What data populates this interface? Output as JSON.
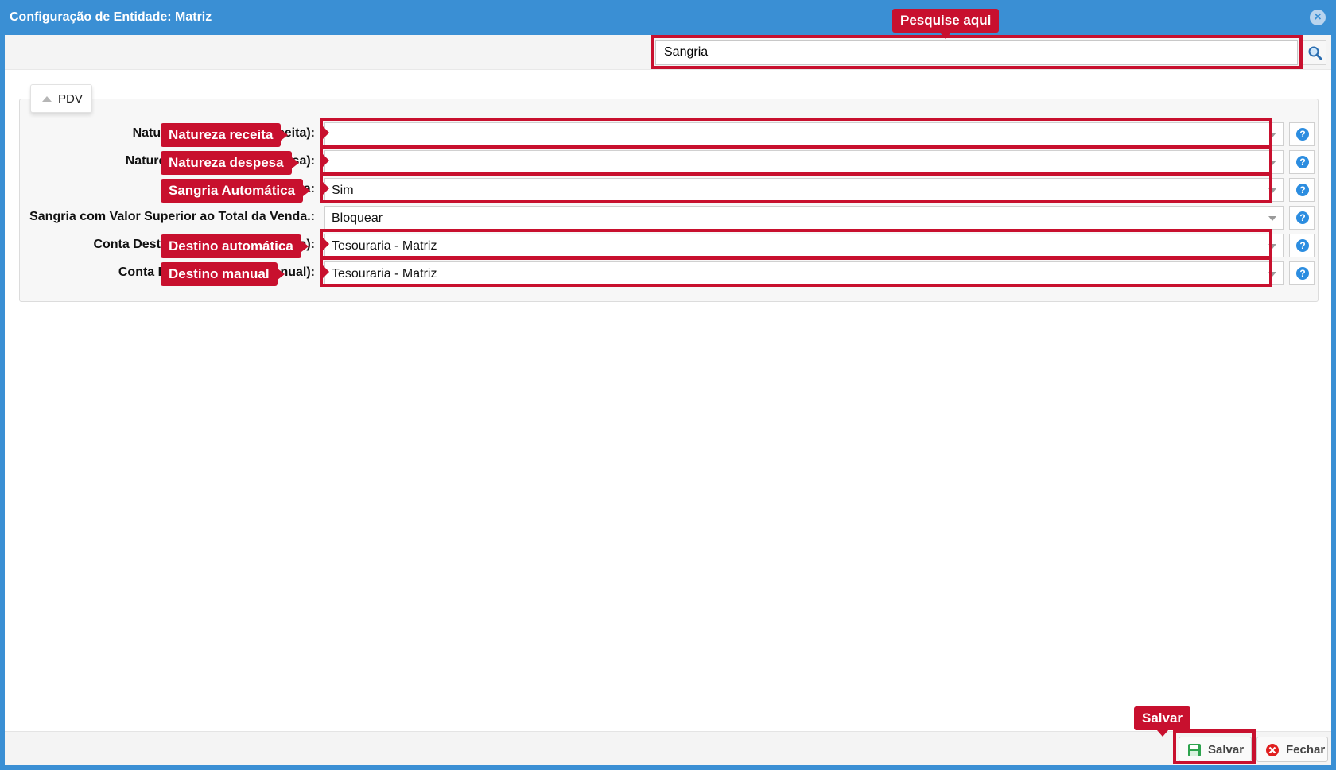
{
  "window": {
    "title": "Configuração de Entidade: Matriz"
  },
  "search": {
    "value": "Sangria"
  },
  "section": {
    "label": "PDV"
  },
  "fields": [
    {
      "label": "Natureza Financeira (Receita):",
      "value": ""
    },
    {
      "label": "Natureza Financeira (Despesa):",
      "value": ""
    },
    {
      "label": "Sangria Automática:",
      "value": "Sim"
    },
    {
      "label": "Sangria com Valor Superior ao Total da Venda.:",
      "value": "Bloquear"
    },
    {
      "label": "Conta Destino (Sangria Automática):",
      "value": "Tesouraria - Matriz"
    },
    {
      "label": "Conta Destino (Sangria Manual):",
      "value": "Tesouraria - Matriz"
    }
  ],
  "callouts": {
    "search": "Pesquise aqui",
    "natureza_receita": "Natureza receita",
    "natureza_despesa": "Natureza despesa",
    "sangria_automatica": "Sangria Automática",
    "destino_automatica": "Destino automática",
    "destino_manual": "Destino manual",
    "salvar": "Salvar"
  },
  "footer": {
    "save_label": "Salvar",
    "close_label": "Fechar"
  },
  "colors": {
    "titlebar": "#3a8fd4",
    "callout": "#c8102e",
    "help": "#2c8de0"
  }
}
